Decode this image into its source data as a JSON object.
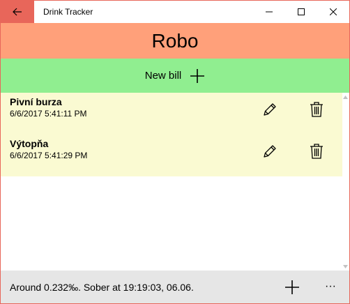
{
  "window": {
    "title": "Drink Tracker",
    "back_icon": "back-arrow-icon",
    "controls": [
      "minimize-icon",
      "maximize-icon",
      "close-icon"
    ]
  },
  "header": {
    "title": "Robo",
    "background": "#ffa07a"
  },
  "new_bill": {
    "label": "New bill",
    "icon": "plus-icon",
    "background": "#90ee90"
  },
  "bills": [
    {
      "name": "Pivní burza",
      "date": "6/6/2017 5:41:11 PM"
    },
    {
      "name": "Výtopňa",
      "date": "6/6/2017 5:41:29 PM"
    }
  ],
  "bill_icons": {
    "edit": "pencil-icon",
    "delete": "trash-icon"
  },
  "bill_background": "#fafad2",
  "bottom_bar": {
    "status": "Around 0.232‰. Sober at 19:19:03, 06.06.",
    "add_icon": "plus-icon",
    "more_label": "···"
  },
  "accent": "#e8665a"
}
